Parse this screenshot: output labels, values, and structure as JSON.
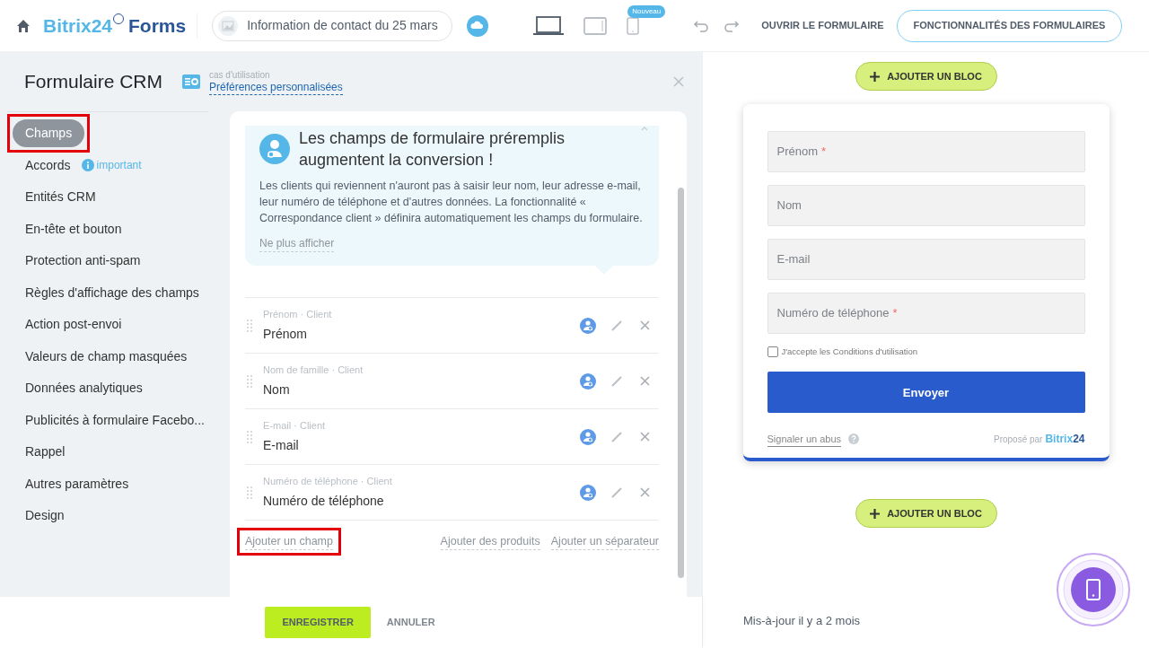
{
  "header": {
    "logo_light": "Bitrix24",
    "logo_dark": "Forms",
    "page_title": "Information de contact du 25 mars",
    "devices": [
      {
        "kind": "laptop",
        "selected": true
      },
      {
        "kind": "tablet",
        "selected": false
      },
      {
        "kind": "phone",
        "selected": false,
        "badge": "Nouveau"
      }
    ],
    "open_form": "OUVRIR LE FORMULAIRE",
    "features": "FONCTIONNALITÉS DES FORMULAIRES"
  },
  "settings": {
    "title": "Formulaire CRM",
    "use_case_label": "cas d'utilisation",
    "use_case": "Préférences personnalisées",
    "sidebar": [
      {
        "label": "Champs",
        "selected": true,
        "annotated": true
      },
      {
        "label": "Accords",
        "selected": false,
        "annotated": false,
        "hint": "important"
      },
      {
        "label": "Entités CRM",
        "selected": false,
        "annotated": false
      },
      {
        "label": "En-tête et bouton",
        "selected": false,
        "annotated": false
      },
      {
        "label": "Protection anti-spam",
        "selected": false,
        "annotated": false
      },
      {
        "label": "Règles d'affichage des champs",
        "selected": false,
        "annotated": false
      },
      {
        "label": "Action post-envoi",
        "selected": false,
        "annotated": false
      },
      {
        "label": "Valeurs de champ masquées",
        "selected": false,
        "annotated": false
      },
      {
        "label": "Données analytiques",
        "selected": false,
        "annotated": false
      },
      {
        "label": "Publicités à formulaire Facebo...",
        "selected": false,
        "annotated": false
      },
      {
        "label": "Rappel",
        "selected": false,
        "annotated": false
      },
      {
        "label": "Autres paramètres",
        "selected": false,
        "annotated": false
      },
      {
        "label": "Design",
        "selected": false,
        "annotated": false
      }
    ],
    "tip": {
      "title": "Les champs de formulaire préremplis augmentent la conversion !",
      "body": "Les clients qui reviennent n'auront pas à saisir leur nom, leur adresse e-mail, leur numéro de téléphone et d'autres données. La fonctionnalité « Correspondance client » définira automatiquement les champs du formulaire.",
      "dismiss": "Ne plus afficher"
    },
    "fields": [
      {
        "source": "Prénom · Client",
        "label": "Prénom"
      },
      {
        "source": "Nom de famille · Client",
        "label": "Nom"
      },
      {
        "source": "E-mail · Client",
        "label": "E-mail"
      },
      {
        "source": "Numéro de téléphone · Client",
        "label": "Numéro de téléphone"
      }
    ],
    "actions": [
      {
        "label": "Ajouter un champ",
        "annotated": true
      },
      {
        "label": "Ajouter des produits",
        "annotated": false
      },
      {
        "label": "Ajouter un séparateur",
        "annotated": false
      }
    ],
    "save": "ENREGISTRER",
    "cancel": "ANNULER"
  },
  "preview": {
    "add_block": "AJOUTER UN BLOC",
    "inputs": [
      {
        "placeholder": "Prénom",
        "required_mark": "*"
      },
      {
        "placeholder": "Nom"
      },
      {
        "placeholder": "E-mail"
      },
      {
        "placeholder": "Numéro de téléphone",
        "required_mark": "*"
      }
    ],
    "consent": {
      "label": "J'accepte les Conditions d'utilisation",
      "checked": false
    },
    "submit": "Envoyer",
    "report": "Signaler un abus",
    "powered_by": "Proposé par",
    "brand_light": "Bitrix",
    "brand_dark": "24",
    "add_block_bottom": "AJOUTER UN BLOC",
    "updated": "Mis-à-jour il y a 2 mois"
  }
}
